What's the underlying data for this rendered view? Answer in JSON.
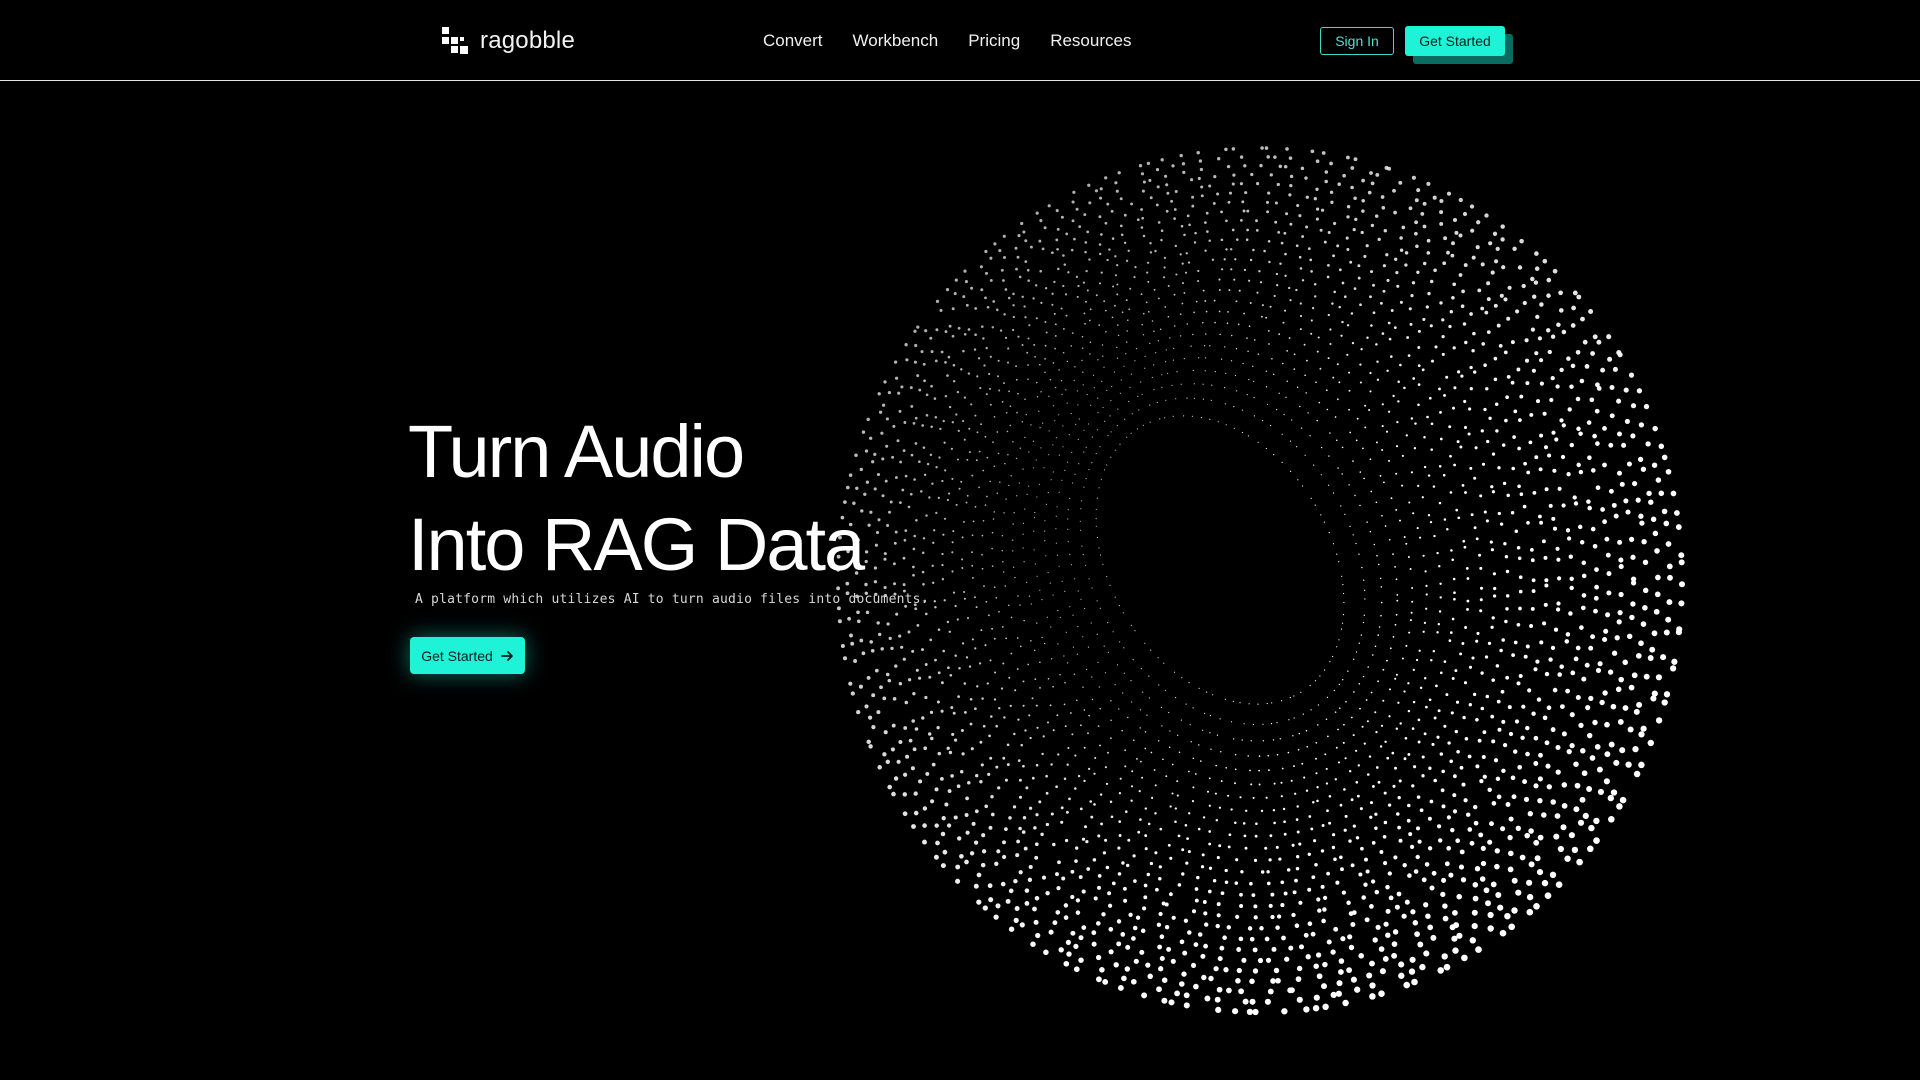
{
  "brand": {
    "name": "ragobble",
    "logo_icon": "pixel-stair-logo-icon"
  },
  "nav": {
    "items": [
      {
        "label": "Convert"
      },
      {
        "label": "Workbench"
      },
      {
        "label": "Pricing"
      },
      {
        "label": "Resources"
      }
    ]
  },
  "header_actions": {
    "sign_in": "Sign In",
    "get_started": "Get Started"
  },
  "hero": {
    "title_line1": "Turn Audio",
    "title_line2": "Into RAG Data",
    "subtitle": "A platform which utilizes AI to turn audio files into documents.",
    "cta_label": "Get Started",
    "cta_icon": "arrow-right-icon"
  },
  "theme": {
    "background": "#000000",
    "accent": "#1ef3d8",
    "accent_shadow": "#0a6b60",
    "text": "#ffffff",
    "dot_color": "#ffffff"
  },
  "illustration": {
    "name": "dotted-torus-illustration"
  }
}
